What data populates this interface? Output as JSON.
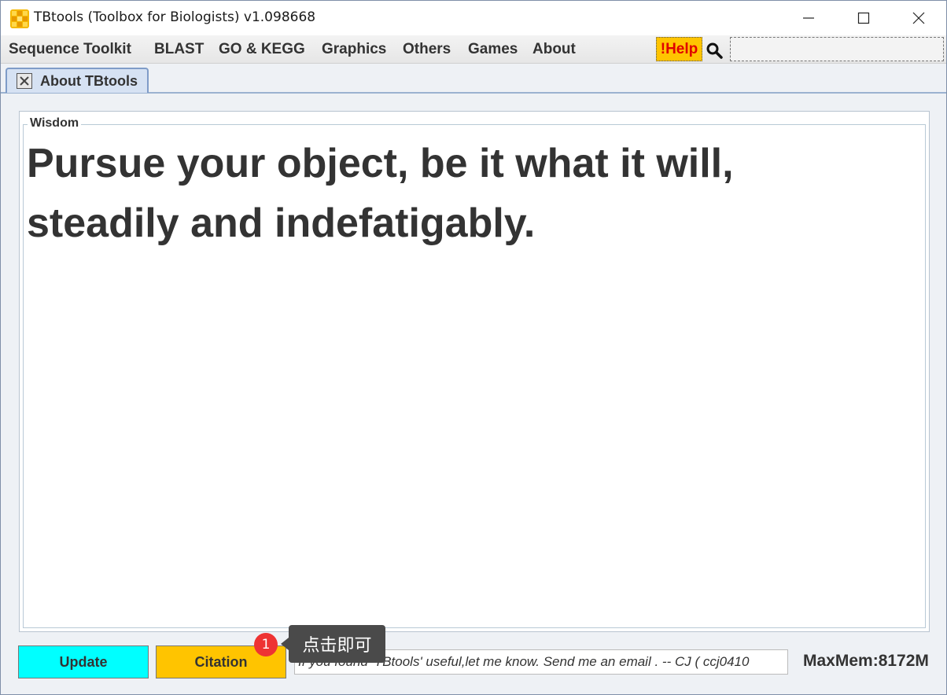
{
  "window": {
    "title": "TBtools (Toolbox for Biologists) v1.098668"
  },
  "menu": {
    "items": [
      "Sequence Toolkit",
      "BLAST",
      "GO & KEGG",
      "Graphics",
      "Others",
      "Games",
      "About"
    ],
    "help_label": "!Help",
    "search_placeholder": ""
  },
  "tabs": [
    {
      "label": "About TBtools",
      "active": true
    }
  ],
  "wisdom": {
    "legend": "Wisdom",
    "quote_line1": "Pursue your object, be it what it will,",
    "quote_line2": "steadily and indefatigably."
  },
  "bottom": {
    "update_label": "Update",
    "citation_label": "Citation",
    "marquee_text": "If you found 'TBtools' useful,let me know. Send me an email . -- CJ   ( ccj0410",
    "maxmem": "MaxMem:8172M"
  },
  "tooltip": {
    "badge": "1",
    "text": "点击即可"
  },
  "colors": {
    "update_bg": "#00ffff",
    "citation_bg": "#ffc400",
    "help_bg": "#ffc400",
    "help_text": "#e00000",
    "badge": "#ee3333"
  }
}
